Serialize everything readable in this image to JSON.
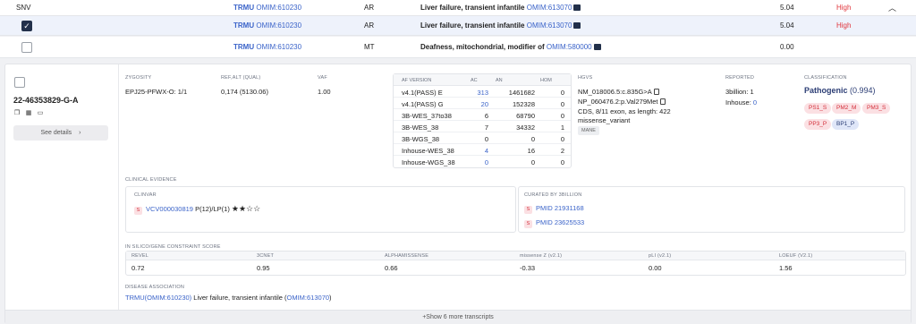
{
  "rows": [
    {
      "type": "SNV",
      "gene": "TRMU",
      "omim": "OMIM:610230",
      "inheritance": "AR",
      "disease": "Liver failure, transient infantile",
      "disease_omim": "OMIM:613070",
      "score": "5.04",
      "impact": "High"
    },
    {
      "gene": "TRMU",
      "omim": "OMIM:610230",
      "inheritance": "AR",
      "disease": "Liver failure, transient infantile",
      "disease_omim": "OMIM:613070",
      "score": "5.04",
      "impact": "High",
      "checked": true
    },
    {
      "gene": "TRMU",
      "omim": "OMIM:610230",
      "inheritance": "MT",
      "disease": "Deafness, mitochondrial, modifier of",
      "disease_omim": "OMIM:580000",
      "score": "0.00",
      "impact": ""
    }
  ],
  "icons": {
    "collapse": "chevron-up-icon",
    "check": "checkmark-icon",
    "book": "book-icon",
    "copy": "copy-icon",
    "igv": "igv-icon",
    "comment": "comment-icon",
    "chevron": "chevron-right-icon"
  },
  "detail": {
    "variant": "22-46353829-G-A",
    "see_details": "See details",
    "zygosity_label": "ZYGOSITY",
    "zygosity_value": "EPJ25-PFWX-O: 1/1",
    "refalt_label": "REF,ALT (QUAL)",
    "refalt_value": "0,174 (5130.06)",
    "vaf_label": "VAF",
    "vaf_value": "1.00",
    "af_headers": [
      "AF VERSION",
      "AC",
      "AN",
      "HOM"
    ],
    "af_rows": [
      {
        "version": "v4.1(PASS) E",
        "ac": "313",
        "an": "1461682",
        "hom": "0",
        "ac_link": true
      },
      {
        "version": "v4.1(PASS) G",
        "ac": "20",
        "an": "152328",
        "hom": "0",
        "ac_link": true
      },
      {
        "version": "3B-WES_37to38",
        "ac": "6",
        "an": "68790",
        "hom": "0"
      },
      {
        "version": "3B-WES_38",
        "ac": "7",
        "an": "34332",
        "hom": "1"
      },
      {
        "version": "3B-WGS_38",
        "ac": "0",
        "an": "0",
        "hom": "0"
      },
      {
        "version": "Inhouse-WES_38",
        "ac": "4",
        "an": "16",
        "hom": "2",
        "ac_link": true
      },
      {
        "version": "Inhouse-WGS_38",
        "ac": "0",
        "an": "0",
        "hom": "0",
        "ac_link": true
      }
    ],
    "hgvs_label": "HGVS",
    "hgvs_c": "NM_018006.5:c.835G>A",
    "hgvs_p": "NP_060476.2:p.Val279Met",
    "hgvs_cds": "CDS, 8/11 exon, as length: 422",
    "hgvs_effect": "missense_variant",
    "hgvs_tag": "MANE",
    "reported_label": "REPORTED",
    "reported_3b_label": "3billion:",
    "reported_3b_value": "1",
    "reported_inhouse_label": "Inhouse:",
    "reported_inhouse_value": "0",
    "classification_label": "CLASSIFICATION",
    "classification_value": "Pathogenic",
    "classification_score": "(0.994)",
    "criteria_pink": [
      "PS1_S",
      "PM2_M",
      "PM3_S",
      "PP3_P"
    ],
    "criteria_blue": [
      "BP1_P"
    ],
    "clinical_evidence_label": "CLINICAL EVIDENCE",
    "clinvar_label": "CLINVAR",
    "clinvar_id": "VCV000030819",
    "clinvar_counts": "P(12)/LP(1)",
    "clinvar_stars": "★★☆☆",
    "s_badge": "S",
    "curated_label": "CURATED BY 3BILLION",
    "pmids": [
      "PMID 21931168",
      "PMID 23625533"
    ],
    "insilico_label": "IN SILICO/GENE CONSTRAINT SCORE",
    "insilico_headers": [
      "REVEL",
      "3Cnet",
      "AlphaMissense",
      "missense Z (v2.1)",
      "pLI (v2.1)",
      "LOEUF (v2.1)"
    ],
    "insilico_values": [
      "0.72",
      "0.95",
      "0.66",
      "-0.33",
      "0.00",
      "1.56"
    ],
    "disease_assoc_label": "DISEASE ASSOCIATION",
    "disease_assoc_gene": "TRMU(OMIM:610230)",
    "disease_assoc_text": "Liver failure, transient infantile",
    "disease_assoc_omim": "OMIM:613070",
    "show_more": "+Show 6 more transcripts"
  },
  "colors": {
    "accent": "#3a63c9",
    "high": "#e0353c",
    "checkbox_on": "#22304a"
  }
}
